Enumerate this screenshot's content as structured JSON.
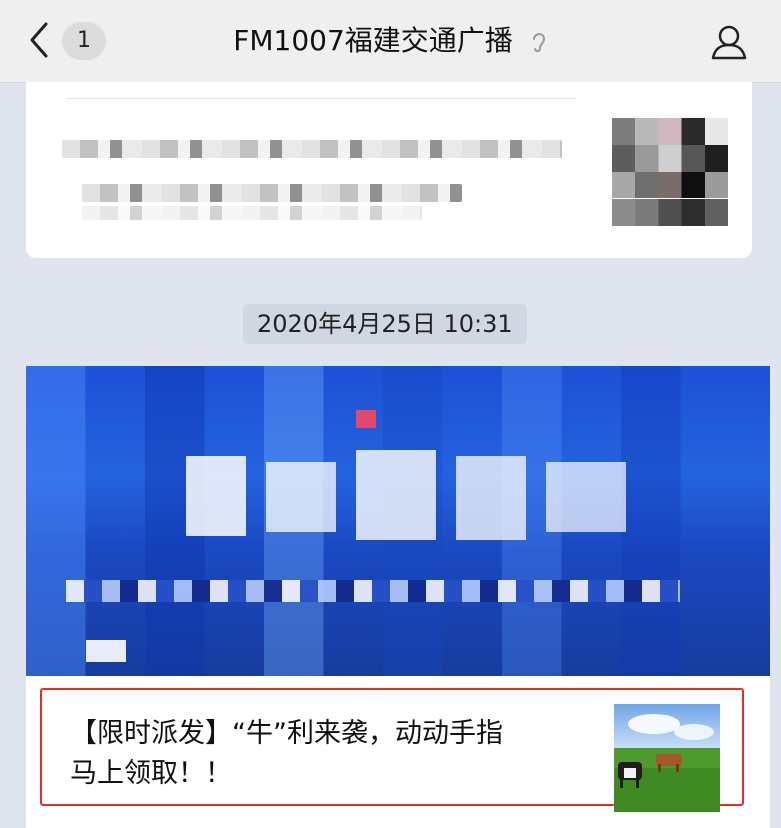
{
  "header": {
    "unread_count": "1",
    "title": "FM1007福建交通广播"
  },
  "timestamp": "2020年4月25日 10:31",
  "article": {
    "title_line1": "【限时派发】“牛”利来袭，动动手指",
    "title_line2": "马上领取！！"
  },
  "colors": {
    "highlight_border": "#e0322a",
    "banner_blue": "#1d50d6"
  }
}
